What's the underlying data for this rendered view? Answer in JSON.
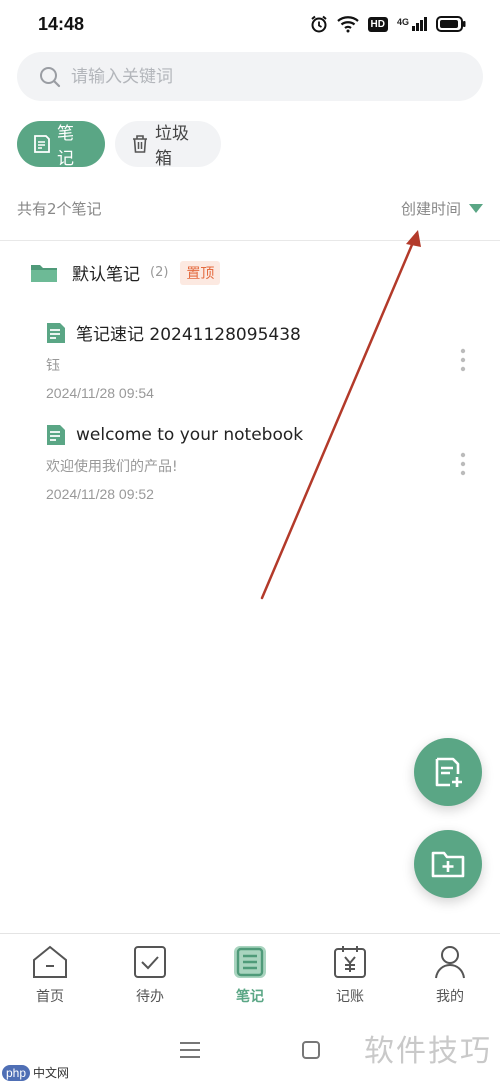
{
  "status": {
    "time": "14:48",
    "network": "4G",
    "hd": "HD"
  },
  "search": {
    "placeholder": "请输入关键词",
    "value": ""
  },
  "tabs": [
    {
      "label": "笔记",
      "icon": "note-icon",
      "active": true
    },
    {
      "label": "垃圾箱",
      "icon": "trash-icon",
      "active": false
    }
  ],
  "list": {
    "count_text": "共有2个笔记",
    "sort_label": "创建时间"
  },
  "folder": {
    "name": "默认笔记",
    "count": "(2)",
    "pin": "置顶"
  },
  "notes": [
    {
      "title": "笔记速记 20241128095438",
      "snippet": "钰",
      "date": "2024/11/28 09:54"
    },
    {
      "title": "welcome to your notebook",
      "snippet": "欢迎使用我们的产品!",
      "date": "2024/11/28 09:52"
    }
  ],
  "nav": [
    {
      "label": "首页",
      "icon": "home-icon"
    },
    {
      "label": "待办",
      "icon": "todo-icon"
    },
    {
      "label": "笔记",
      "icon": "note-icon",
      "active": true
    },
    {
      "label": "记账",
      "icon": "ledger-icon"
    },
    {
      "label": "我的",
      "icon": "profile-icon"
    }
  ],
  "colors": {
    "accent": "#5aa685",
    "pin_bg": "#fce9e1",
    "pin_text": "#e46a3e",
    "annotation_arrow": "#b33a2a"
  },
  "watermark": {
    "text": "软件技巧",
    "logo_php": "php",
    "logo_cn": "中文网"
  }
}
